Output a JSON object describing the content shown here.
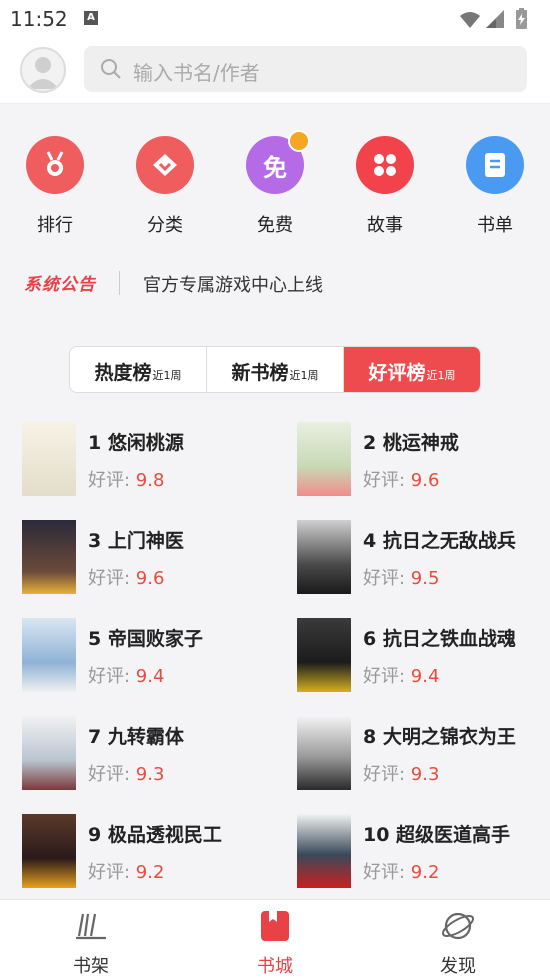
{
  "status_bar": {
    "time": "11:52",
    "a_icon": "A"
  },
  "search": {
    "placeholder": "输入书名/作者"
  },
  "categories": [
    {
      "label": "排行",
      "icon": "medal-icon",
      "color": "#f05d5f"
    },
    {
      "label": "分类",
      "icon": "diamond-icon",
      "color": "#f05d5f"
    },
    {
      "label": "免费",
      "icon": "free-icon",
      "icon_text": "免",
      "color": "#b56be6"
    },
    {
      "label": "故事",
      "icon": "grid-icon",
      "color": "#f2434d"
    },
    {
      "label": "书单",
      "icon": "list-icon",
      "color": "#4a9af2"
    }
  ],
  "notice": {
    "tag": "系统公告",
    "text": "官方专属游戏中心上线"
  },
  "tabs": [
    {
      "label": "热度榜",
      "sub": "近1周",
      "active": false
    },
    {
      "label": "新书榜",
      "sub": "近1周",
      "active": false
    },
    {
      "label": "好评榜",
      "sub": "近1周",
      "active": true
    }
  ],
  "rating_label": "好评: ",
  "books": [
    {
      "title": "1 悠闲桃源",
      "score": "9.8"
    },
    {
      "title": "2 桃运神戒",
      "score": "9.6"
    },
    {
      "title": "3 上门神医",
      "score": "9.6"
    },
    {
      "title": "4 抗日之无敌战兵",
      "score": "9.5"
    },
    {
      "title": "5 帝国败家子",
      "score": "9.4"
    },
    {
      "title": "6 抗日之铁血战魂",
      "score": "9.4"
    },
    {
      "title": "7 九转霸体",
      "score": "9.3"
    },
    {
      "title": "8 大明之锦衣为王",
      "score": "9.3"
    },
    {
      "title": "9 极品透视民工",
      "score": "9.2"
    },
    {
      "title": "10 超级医道高手",
      "score": "9.2"
    }
  ],
  "bottom_nav": [
    {
      "label": "书架",
      "icon": "bookshelf-icon",
      "active": false
    },
    {
      "label": "书城",
      "icon": "bookstore-icon",
      "active": true
    },
    {
      "label": "发现",
      "icon": "discover-icon",
      "active": false
    }
  ],
  "colors": {
    "accent": "#e84148",
    "score": "#e84c3d"
  }
}
